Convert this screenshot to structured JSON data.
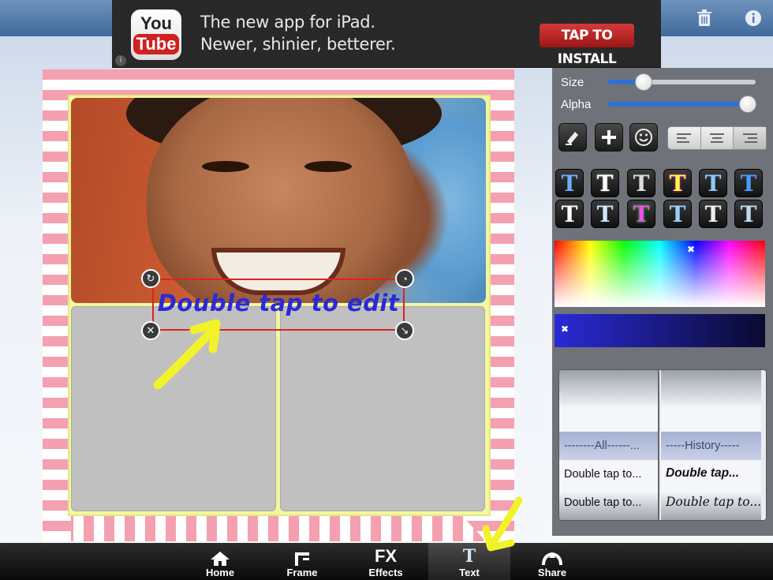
{
  "ad": {
    "logo_top": "You",
    "logo_bottom": "Tube",
    "line1": "The new app for iPad.",
    "line2": "Newer, shinier, betterer.",
    "install_label": "TAP TO INSTALL",
    "info_label": "i"
  },
  "toolbar": {
    "trash_icon": "trash-icon",
    "info_icon": "info-icon"
  },
  "canvas": {
    "text_label": "Double tap to edit"
  },
  "panel": {
    "size_label": "Size",
    "size_value": 0.18,
    "alpha_label": "Alpha",
    "alpha_value": 1.0
  },
  "history": {
    "col_all_header": "--------All------...",
    "col_history_header": "-----History-----",
    "all_items": [
      "Double tap to...",
      "Double tap to..."
    ],
    "history_items": [
      "Double tap...",
      "Double tap to..."
    ]
  },
  "tabs": [
    {
      "label": "Home",
      "icon": "home-icon"
    },
    {
      "label": "Frame",
      "icon": "frame-icon"
    },
    {
      "label": "Effects",
      "icon": "fx-icon",
      "glyph": "FX"
    },
    {
      "label": "Text",
      "icon": "text-icon",
      "glyph": "T"
    },
    {
      "label": "Share",
      "icon": "share-icon"
    }
  ],
  "colors": {
    "accent": "#2a2ad6",
    "selection_border": "#dd2222",
    "frame_stripe": "#f4a0b0"
  }
}
